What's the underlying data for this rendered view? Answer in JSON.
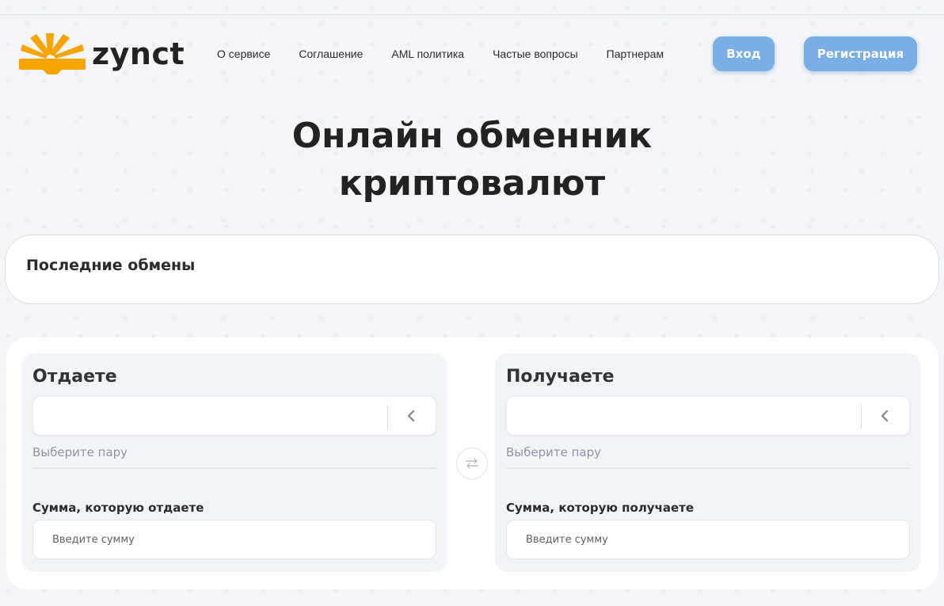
{
  "brand": {
    "name": "zynct",
    "accent": "#f7a300"
  },
  "nav": {
    "items": [
      {
        "label": "О сервисе"
      },
      {
        "label": "Соглашение"
      },
      {
        "label": "AML политика"
      },
      {
        "label": "Частые вопросы"
      },
      {
        "label": "Партнерам"
      }
    ]
  },
  "auth": {
    "login_label": "Вход",
    "register_label": "Регистрация"
  },
  "hero": {
    "title_line1": "Онлайн обменник",
    "title_line2": "криптовалют"
  },
  "recent": {
    "title": "Последние обмены"
  },
  "exchange": {
    "give": {
      "title": "Отдаете",
      "pair_label": "Выберите пару",
      "amount_label": "Сумма, которую отдаете",
      "amount_placeholder": "Введите сумму"
    },
    "get": {
      "title": "Получаете",
      "pair_label": "Выберите пару",
      "amount_label": "Сумма, которую получаете",
      "amount_placeholder": "Введите сумму"
    },
    "swap_icon": "swap-arrows-icon",
    "select_icon": "chevron-left-icon"
  }
}
